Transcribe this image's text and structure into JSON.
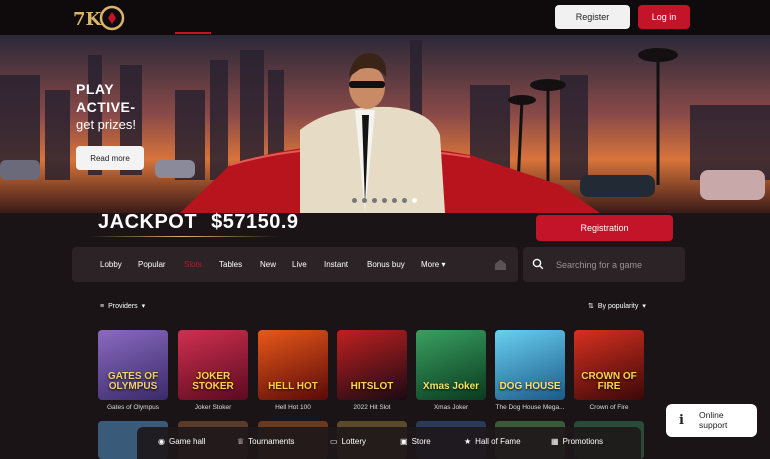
{
  "header": {
    "logo_text": "7K",
    "register_label": "Register",
    "login_label": "Log in"
  },
  "hero": {
    "line1": "PLAY",
    "line2": "ACTIVE-",
    "line3": "get prizes!",
    "read_more_label": "Read more",
    "slides_count": 7,
    "active_slide": 7
  },
  "jackpot": {
    "label": "JACKPOT",
    "value": "$57150.9"
  },
  "registration_label": "Registration",
  "nav": {
    "items": [
      {
        "label": "Lobby"
      },
      {
        "label": "Popular"
      },
      {
        "label": "Slots"
      },
      {
        "label": "Tables"
      },
      {
        "label": "New"
      },
      {
        "label": "Live"
      },
      {
        "label": "Instant"
      },
      {
        "label": "Bonus buy"
      },
      {
        "label": "More"
      }
    ],
    "active": "Slots"
  },
  "search": {
    "placeholder": "Searching for a game"
  },
  "filters": {
    "providers_label": "Providers",
    "sort_label": "By popularity"
  },
  "games": [
    {
      "title": "Gates of Olympus",
      "art": "GATES OF OLYMPUS",
      "color": "#5a3a8a"
    },
    {
      "title": "Joker Stoker",
      "art": "JOKER STOKER",
      "color": "#8a1a30"
    },
    {
      "title": "Hell Hot 100",
      "art": "HELL HOT",
      "color": "#7a1a10"
    },
    {
      "title": "2022 Hit Slot",
      "art": "HITSLOT",
      "color": "#3a1a2a"
    },
    {
      "title": "Xmas Joker",
      "art": "Xmas Joker",
      "color": "#1a5a3a"
    },
    {
      "title": "The Dog House Mega...",
      "art": "DOG HOUSE",
      "color": "#2a7aa0"
    },
    {
      "title": "Crown of Fire",
      "art": "CROWN OF FIRE",
      "color": "#7a1010"
    }
  ],
  "bottom_nav": [
    {
      "label": "Game hall",
      "icon": "controller-icon"
    },
    {
      "label": "Tournaments",
      "icon": "trophy-icon"
    },
    {
      "label": "Lottery",
      "icon": "ticket-icon"
    },
    {
      "label": "Store",
      "icon": "bag-icon"
    },
    {
      "label": "Hall of Fame",
      "icon": "star-icon"
    },
    {
      "label": "Promotions",
      "icon": "gift-icon"
    }
  ],
  "support": {
    "line1": "Online",
    "line2": "support"
  },
  "colors": {
    "accent": "#c4142a",
    "background": "#1a1416",
    "panel": "#2b2325"
  }
}
